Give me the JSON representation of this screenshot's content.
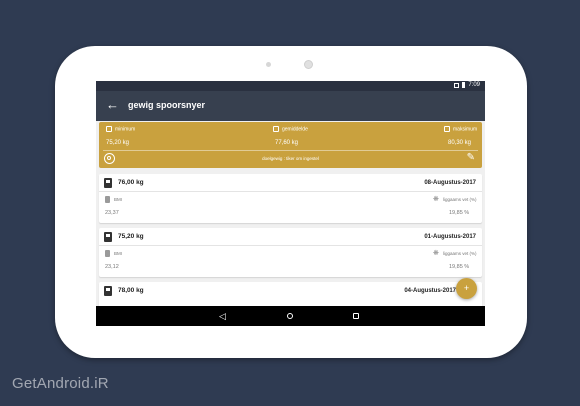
{
  "status_bar": {
    "time": "7:09",
    "icons": [
      "sim-icon",
      "battery-icon"
    ]
  },
  "app_bar": {
    "back_icon": "arrow-left-icon",
    "title": "gewig spoorsnyer"
  },
  "summary": {
    "minimum_label": "minimum",
    "minimum_value": "75,20 kg",
    "average_label": "gemiddelde",
    "average_value": "77,60 kg",
    "maximum_label": "maksimum",
    "maximum_value": "80,30 kg",
    "goal_text": "doelgewig : tiker om ingestel",
    "accent_color": "#c9a13e"
  },
  "entries": [
    {
      "weight": "76,00 kg",
      "date": "08-Augustus-2017",
      "bmi_label": "BMI",
      "bmi_value": "23,37",
      "fat_label": "liggaams vet (%)",
      "fat_value": "19,85 %"
    },
    {
      "weight": "75,20 kg",
      "date": "01-Augustus-2017",
      "bmi_label": "BMI",
      "bmi_value": "23,12",
      "fat_label": "liggaams vet (%)",
      "fat_value": "19,85 %"
    },
    {
      "weight": "78,00 kg",
      "date": "04-Augustus-2017"
    }
  ],
  "fab": {
    "label": "+"
  },
  "nav": {
    "back": "◁"
  },
  "watermark": "GetAndroid.iR"
}
